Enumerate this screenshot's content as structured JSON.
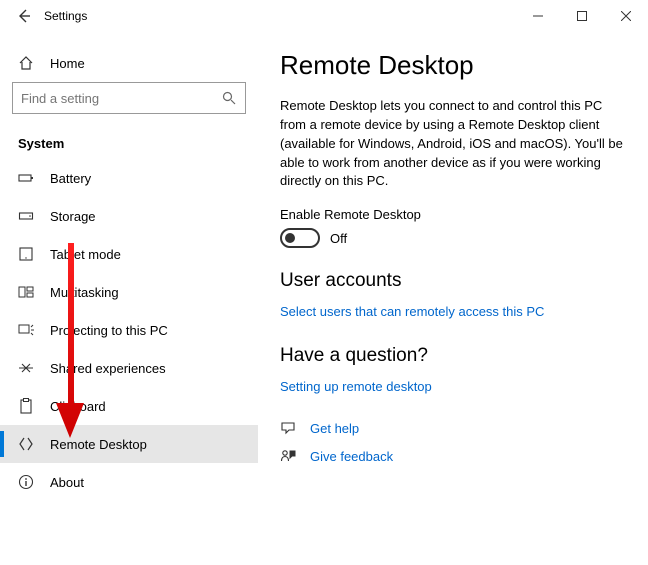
{
  "window": {
    "title": "Settings",
    "controls": {
      "min": "—",
      "max": "▢",
      "close": "✕"
    }
  },
  "sidebar": {
    "home_label": "Home",
    "search_placeholder": "Find a setting",
    "section_label": "System",
    "items": [
      {
        "label": "Battery",
        "icon": "battery-icon",
        "selected": false
      },
      {
        "label": "Storage",
        "icon": "storage-icon",
        "selected": false
      },
      {
        "label": "Tablet mode",
        "icon": "tablet-icon",
        "selected": false
      },
      {
        "label": "Multitasking",
        "icon": "multitasking-icon",
        "selected": false
      },
      {
        "label": "Projecting to this PC",
        "icon": "project-icon",
        "selected": false
      },
      {
        "label": "Shared experiences",
        "icon": "shared-icon",
        "selected": false
      },
      {
        "label": "Clipboard",
        "icon": "clipboard-icon",
        "selected": false
      },
      {
        "label": "Remote Desktop",
        "icon": "remote-icon",
        "selected": true
      },
      {
        "label": "About",
        "icon": "about-icon",
        "selected": false
      }
    ]
  },
  "main": {
    "title": "Remote Desktop",
    "description": "Remote Desktop lets you connect to and control this PC from a remote device by using a Remote Desktop client (available for Windows, Android, iOS and macOS). You'll be able to work from another device as if you were working directly on this PC.",
    "toggle": {
      "label": "Enable Remote Desktop",
      "state": "Off"
    },
    "user_accounts": {
      "heading": "User accounts",
      "link": "Select users that can remotely access this PC"
    },
    "question": {
      "heading": "Have a question?",
      "link": "Setting up remote desktop"
    },
    "help": {
      "get_help": "Get help",
      "feedback": "Give feedback"
    }
  },
  "colors": {
    "accent": "#0078d7",
    "link": "#0066cc"
  }
}
